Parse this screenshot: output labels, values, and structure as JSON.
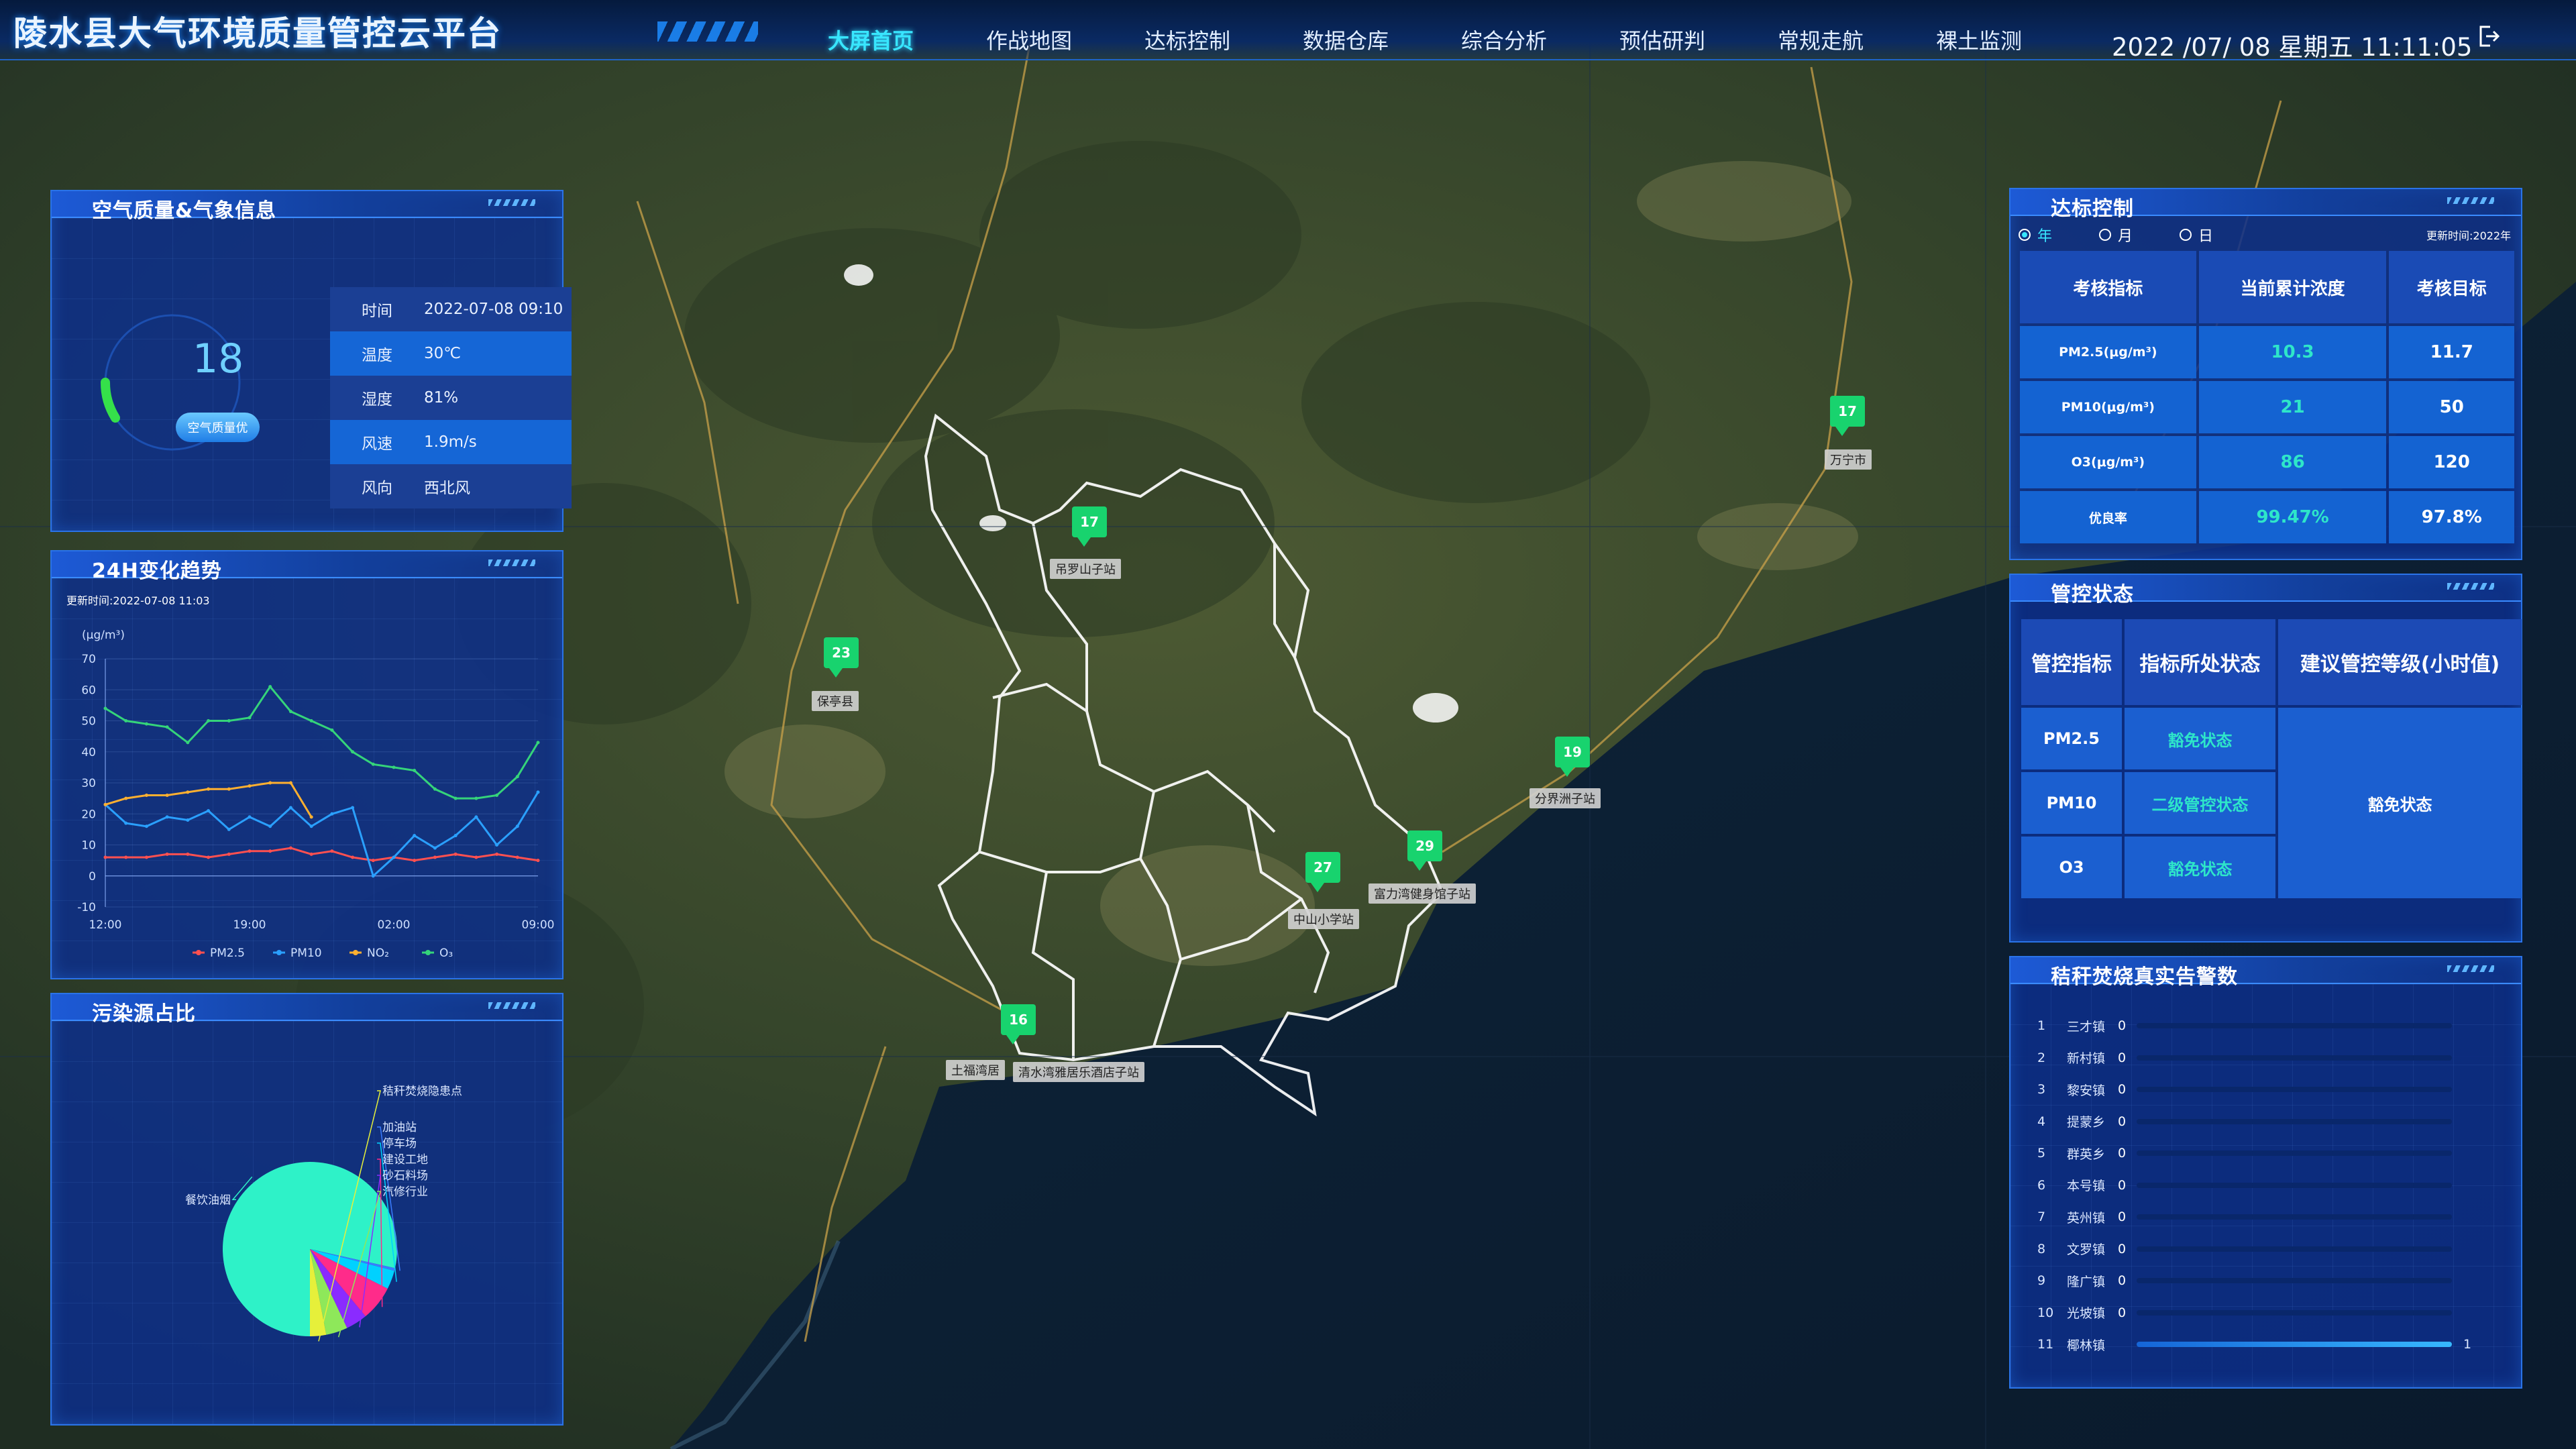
{
  "header": {
    "title": "陵水县大气环境质量管控云平台",
    "nav": [
      "大屏首页",
      "作战地图",
      "达标控制",
      "数据仓库",
      "综合分析",
      "预估研判",
      "常规走航",
      "裸土监测"
    ],
    "active_index": 0,
    "datetime": "2022 /07/ 08 星期五 11:11:05"
  },
  "weather_panel": {
    "title": "空气质量&气象信息",
    "aqi": "18",
    "aqi_label": "空气质量优",
    "rows": [
      {
        "key": "时间",
        "value": "2022-07-08 09:10"
      },
      {
        "key": "温度",
        "value": "30℃"
      },
      {
        "key": "湿度",
        "value": "81%"
      },
      {
        "key": "风速",
        "value": "1.9m/s"
      },
      {
        "key": "风向",
        "value": "西北风"
      }
    ]
  },
  "trend_panel": {
    "title": "24H变化趋势",
    "updated": "更新时间:2022-07-08 11:03"
  },
  "chart_data": [
    {
      "type": "line",
      "ylabel": "(μg/m³)",
      "ylim": [
        -10,
        70
      ],
      "yticks": [
        -10,
        0,
        10,
        20,
        30,
        40,
        50,
        60,
        70
      ],
      "xtick_labels": [
        "12:00",
        "19:00",
        "02:00",
        "09:00"
      ],
      "xtick_positions": [
        0,
        7,
        14,
        21
      ],
      "series": [
        {
          "name": "PM2.5",
          "color": "#ff5050",
          "values": [
            6,
            6,
            6,
            7,
            7,
            6,
            7,
            8,
            8,
            9,
            7,
            8,
            6,
            5,
            6,
            5,
            6,
            7,
            6,
            7,
            6,
            5
          ]
        },
        {
          "name": "PM10",
          "color": "#2aa0ff",
          "values": [
            23,
            17,
            16,
            19,
            18,
            21,
            15,
            19,
            16,
            22,
            16,
            20,
            22,
            0,
            6,
            13,
            9,
            13,
            19,
            10,
            16,
            27
          ]
        },
        {
          "name": "NO₂",
          "color": "#ffb030",
          "values": [
            23,
            25,
            26,
            26,
            27,
            28,
            28,
            29,
            30,
            30,
            19,
            null,
            null,
            null,
            null,
            null,
            null,
            null,
            null,
            null,
            null,
            null
          ]
        },
        {
          "name": "O₃",
          "color": "#35d47a",
          "values": [
            54,
            50,
            49,
            48,
            43,
            50,
            50,
            51,
            61,
            53,
            50,
            47,
            40,
            36,
            35,
            34,
            28,
            25,
            25,
            26,
            32,
            43
          ]
        }
      ]
    },
    {
      "type": "pie",
      "labels": [
        "餐饮油烟",
        "加油站",
        "停车场",
        "建设工地",
        "砂石料场",
        "汽修行业",
        "秸秆焚烧隐患点"
      ],
      "values": [
        78.5,
        0.5,
        3.5,
        6.5,
        4,
        4,
        3
      ],
      "colors": [
        "#2ef2c8",
        "#3a7cff",
        "#00d1ff",
        "#ff2b8a",
        "#8a2bff",
        "#8ee85a",
        "#e6f03a"
      ]
    }
  ],
  "pollution_panel": {
    "title": "污染源占比"
  },
  "standard_panel": {
    "title": "达标控制",
    "radios": [
      "年",
      "月",
      "日"
    ],
    "selected": 0,
    "updated": "更新时间:2022年",
    "headers": [
      "考核指标",
      "当前累计浓度",
      "考核目标"
    ],
    "rows": [
      {
        "name": "PM2.5(μg/m³)",
        "current": "10.3",
        "target": "11.7"
      },
      {
        "name": "PM10(μg/m³)",
        "current": "21",
        "target": "50"
      },
      {
        "name": "O3(μg/m³)",
        "current": "86",
        "target": "120"
      },
      {
        "name": "优良率",
        "current": "99.47%",
        "target": "97.8%"
      }
    ]
  },
  "control_panel": {
    "title": "管控状态",
    "headers": [
      "管控指标",
      "指标所处状态",
      "建议管控等级(小时值)"
    ],
    "rows": [
      {
        "name": "PM2.5",
        "state": "豁免状态"
      },
      {
        "name": "PM10",
        "state": "二级管控状态"
      },
      {
        "name": "O3",
        "state": "豁免状态"
      }
    ],
    "suggest": "豁免状态"
  },
  "burn_panel": {
    "title": "秸秆焚烧真实告警数",
    "max": 1,
    "rows": [
      {
        "idx": "1",
        "name": "三才镇",
        "value": 0
      },
      {
        "idx": "2",
        "name": "新村镇",
        "value": 0
      },
      {
        "idx": "3",
        "name": "黎安镇",
        "value": 0
      },
      {
        "idx": "4",
        "name": "提蒙乡",
        "value": 0
      },
      {
        "idx": "5",
        "name": "群英乡",
        "value": 0
      },
      {
        "idx": "6",
        "name": "本号镇",
        "value": 0
      },
      {
        "idx": "7",
        "name": "英州镇",
        "value": 0
      },
      {
        "idx": "8",
        "name": "文罗镇",
        "value": 0
      },
      {
        "idx": "9",
        "name": "隆广镇",
        "value": 0
      },
      {
        "idx": "10",
        "name": "光坡镇",
        "value": 0
      },
      {
        "idx": "11",
        "name": "椰林镇",
        "value": 1
      }
    ]
  },
  "map": {
    "labels": [
      "吊罗山子站",
      "保亭县",
      "分界洲子站",
      "富力湾健身馆子站",
      "中山小学站",
      "土福湾居",
      "清水湾雅居乐酒店子站",
      "万宁市"
    ],
    "markers": [
      "17",
      "23",
      "19",
      "29",
      "27",
      "16",
      "17"
    ]
  }
}
